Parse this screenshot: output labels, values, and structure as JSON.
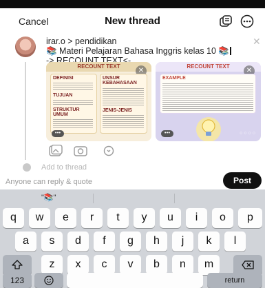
{
  "header": {
    "cancel_label": "Cancel",
    "title": "New thread",
    "icons": [
      "draft-icon",
      "more-options-icon"
    ]
  },
  "post": {
    "breadcrumb": "irar.o > pendidikan",
    "line1": "📚 Materi Pelajaran Bahasa Inggris kelas 10 📚",
    "line2": "-> RECOUNT TEXT<-",
    "attachments": [
      {
        "title": "RECOUNT TEXT",
        "sections": [
          "DEFINISI",
          "TUJUAN",
          "STRUKTUR UMUM",
          "UNSUR KEBAHASAAN",
          "JENIS-JENIS"
        ],
        "palette": {
          "bg": "#f7eedc",
          "accent": "#9a3a2a"
        }
      },
      {
        "title": "RECOUNT TEXT",
        "sections": [
          "EXAMPLE"
        ],
        "palette": {
          "bg": "#d8d3ee",
          "accent": "#c2463a"
        }
      }
    ],
    "tools": [
      "gallery-icon",
      "camera-icon",
      "location-icon"
    ],
    "add_to_thread": "Add to thread"
  },
  "footer": {
    "reply_permission": "Anyone can reply & quote",
    "post_label": "Post"
  },
  "keyboard": {
    "suggestion": "\"📚\"",
    "row1": [
      "q",
      "w",
      "e",
      "r",
      "t",
      "y",
      "u",
      "i",
      "o",
      "p"
    ],
    "row2": [
      "a",
      "s",
      "d",
      "f",
      "g",
      "h",
      "j",
      "k",
      "l"
    ],
    "row3": [
      "z",
      "x",
      "c",
      "v",
      "b",
      "n",
      "m"
    ],
    "numbers_label": "123",
    "return_label": "return"
  }
}
